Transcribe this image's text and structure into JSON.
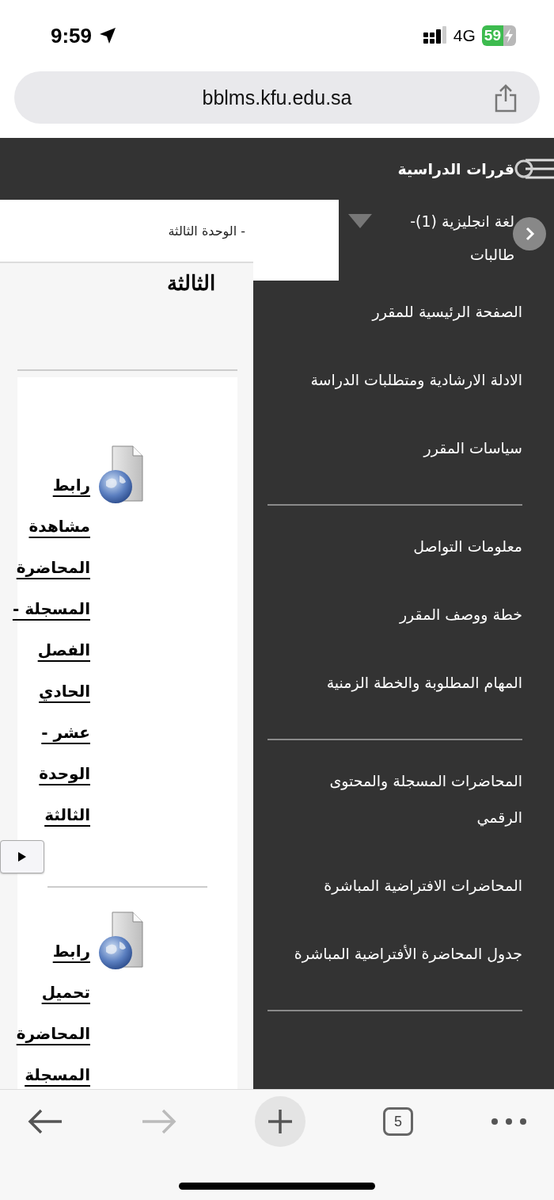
{
  "status_bar": {
    "time": "9:59",
    "network": "4G",
    "battery": "59"
  },
  "address_bar": {
    "url": "bblms.kfu.edu.sa"
  },
  "header": {
    "title": "قررات الدراسية"
  },
  "breadcrumb": "- الوحدة الثالثة",
  "content": {
    "heading": "الثالثة",
    "items": [
      {
        "link": "رابط مشاهدة المحاضرة المسجلة - الفصل الحادي عشر - الوحدة الثالثة"
      },
      {
        "link": "رابط تحميل المحاضرة المسجلة"
      }
    ]
  },
  "course": {
    "title": "لغة انجليزية (1)- طالبات"
  },
  "menu": {
    "groups": [
      {
        "items": [
          "الصفحة الرئيسية للمقرر",
          "الادلة الارشادية ومتطلبات الدراسة",
          "سياسات المقرر"
        ]
      },
      {
        "items": [
          "معلومات التواصل",
          "خطة ووصف المقرر",
          "المهام المطلوبة والخطة الزمنية"
        ]
      },
      {
        "items": [
          "المحاضرات المسجلة والمحتوى الرقمي",
          "المحاضرات الافتراضية المباشرة",
          "جدول المحاضرة الأفتراضية المباشرة"
        ]
      }
    ]
  },
  "toolbar": {
    "tab_count": "5"
  }
}
